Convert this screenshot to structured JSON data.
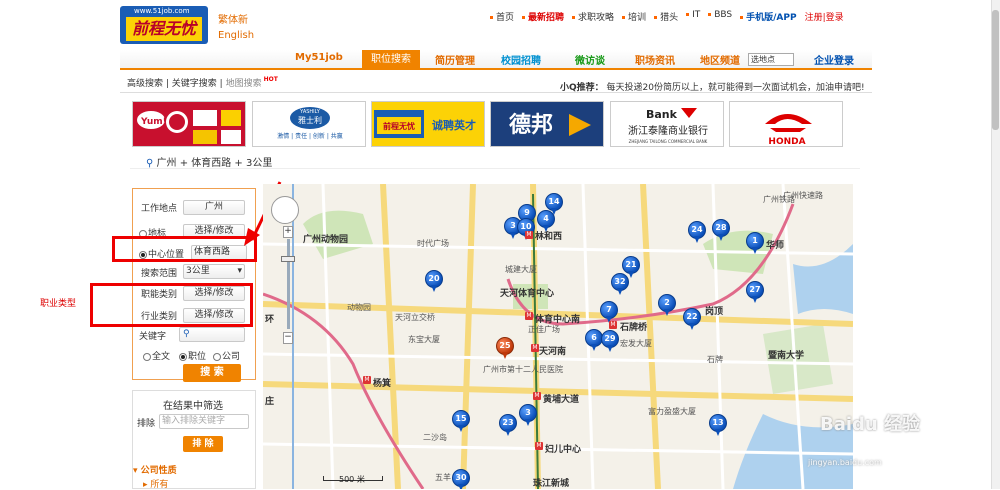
{
  "header": {
    "logo_url": "www.51job.com",
    "logo_text": "前程无忧",
    "lang_traditional": "繁体新",
    "lang_english": "English",
    "top_links": [
      "首页",
      "最新招聘",
      "求职攻略",
      "培训",
      "猎头",
      "IT",
      "BBS",
      "手机版/APP"
    ],
    "register_login": "注册|登录"
  },
  "nav": {
    "items": [
      "My51job",
      "职位搜索",
      "简历管理",
      "校园招聘",
      "微访谈",
      "职场资讯",
      "地区频道",
      "企业登录"
    ],
    "region_select": "选地点"
  },
  "subnav": {
    "items": [
      "高级搜索",
      "关键字搜索",
      "地图搜索"
    ],
    "hot": "HOT",
    "ticker_label": "小Q推荐：",
    "ticker_text": "每天投递20份简历以上，就可能得到一次面试机会，加油申请吧!"
  },
  "ads": [
    "Yum!",
    "雅士利",
    "前程无忧 诚聘英才",
    "德邦",
    "浙江泰隆商业银行",
    "HONDA"
  ],
  "ad_subtexts": {
    "yashili_brand": "YASHILY",
    "yashili_slogan": "激情 | 责任 | 创新 | 共赢",
    "bank_en": "Bank",
    "bank_subtitle": "ZHEJIANG TAILONG COMMERCIAL BANK"
  },
  "breadcrumb": "广州 + 体育西路 + 3公里",
  "search_panel": {
    "work_location_label": "工作地点",
    "work_location_value": "广州",
    "landmark_label": "地标",
    "landmark_button": "选择/修改",
    "center_label": "中心位置",
    "center_value": "体育西路",
    "range_label": "搜索范围",
    "range_value": "3公里",
    "function_label": "职能类别",
    "function_button": "选择/修改",
    "industry_label": "行业类别",
    "industry_button": "选择/修改",
    "keyword_label": "关键字",
    "scope_options": [
      "全文",
      "职位",
      "公司"
    ],
    "search_button": "搜 索"
  },
  "filter_panel": {
    "title": "在结果中筛选",
    "exclude_label": "排除",
    "exclude_placeholder": "输入排除关键字",
    "exclude_button": "排 除",
    "company_nature": "公司性质",
    "all": "所有"
  },
  "annotation": "职业类型",
  "map": {
    "labels": [
      "广州动物园",
      "动物园",
      "时代广场",
      "林和西",
      "城建大厦",
      "天河体育中心",
      "天河立交桥",
      "正佳广场",
      "体育中心南",
      "石牌桥",
      "宏发大厦",
      "天河南",
      "广州市第十二人民医院",
      "东宝大厦",
      "杨箕",
      "黄埔大道",
      "富力盈盛大厦",
      "暨南大学",
      "石牌",
      "广州铁路",
      "二沙岛",
      "五羊",
      "妇儿中心",
      "珠江新城",
      "广州快速路",
      "岗顶",
      "华师",
      "环",
      "庄"
    ],
    "pins": [
      "9",
      "14",
      "3",
      "10",
      "4",
      "24",
      "28",
      "1",
      "20",
      "21",
      "32",
      "27",
      "2",
      "22",
      "7",
      "6",
      "29",
      "25",
      "3",
      "15",
      "23",
      "13",
      "30"
    ],
    "scale": "500 米",
    "watermark": "Baidu 经验",
    "watermark_url": "jingyan.baidu.com"
  }
}
